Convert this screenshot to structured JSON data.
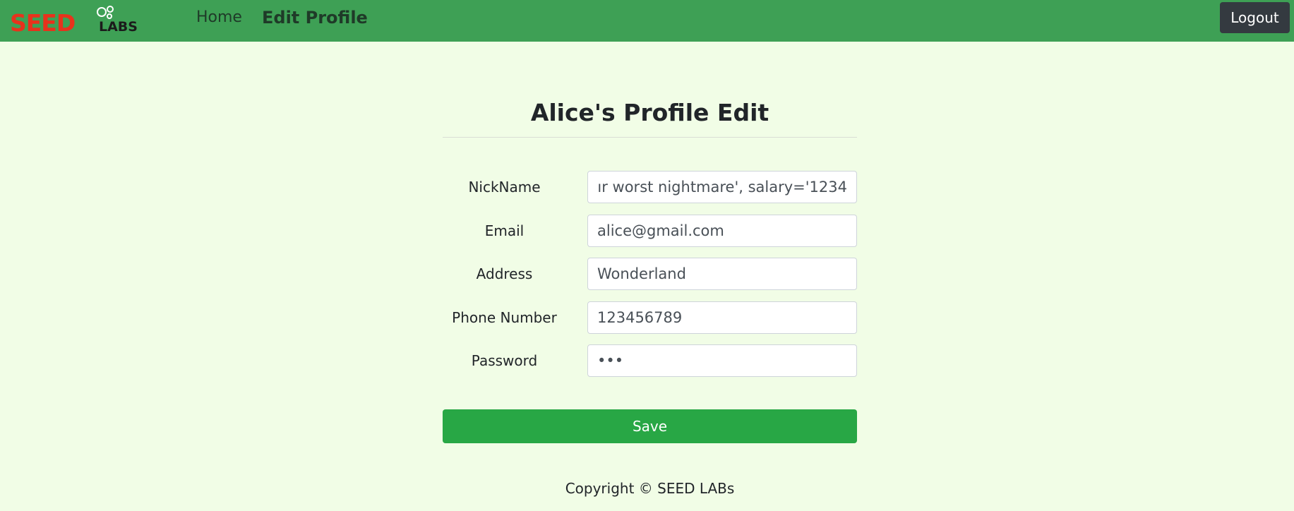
{
  "navbar": {
    "logo_text": "SEED LABS",
    "home_label": "Home",
    "edit_profile_label": "Edit Profile",
    "logout_label": "Logout",
    "background_color": "#3ea055"
  },
  "page": {
    "title": "Alice's Profile Edit",
    "background_color": "#f1fde6"
  },
  "form": {
    "fields": [
      {
        "label": "NickName",
        "value": "ır worst nightmare', salary='1234"
      },
      {
        "label": "Email",
        "value": "alice@gmail.com"
      },
      {
        "label": "Address",
        "value": "Wonderland"
      },
      {
        "label": "Phone Number",
        "value": "123456789"
      },
      {
        "label": "Password",
        "value": "•••"
      }
    ],
    "save_label": "Save",
    "save_color": "#28a745"
  },
  "footer": {
    "text": "Copyright © SEED LABs"
  }
}
